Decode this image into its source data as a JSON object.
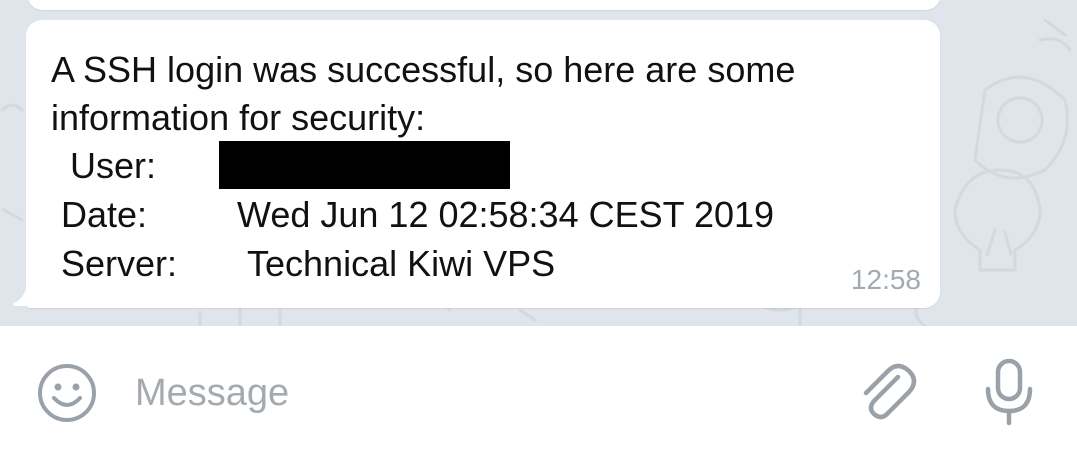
{
  "message": {
    "line1": "A SSH login was successful, so here are some",
    "line2": "information for security:",
    "user_label": "User:",
    "date_label": "Date:",
    "date_value": "Wed Jun 12 02:58:34 CEST 2019",
    "server_label": "Server:",
    "server_value": "Technical Kiwi VPS",
    "time": "12:58"
  },
  "composer": {
    "placeholder": "Message"
  },
  "icons": {
    "emoji": "emoji-icon",
    "attach": "paperclip-icon",
    "mic": "microphone-icon"
  },
  "colors": {
    "chat_background": "#dfe5ea",
    "bubble": "#ffffff",
    "timestamp": "#a1a9b1",
    "icon_gray": "#9aa1a8"
  }
}
